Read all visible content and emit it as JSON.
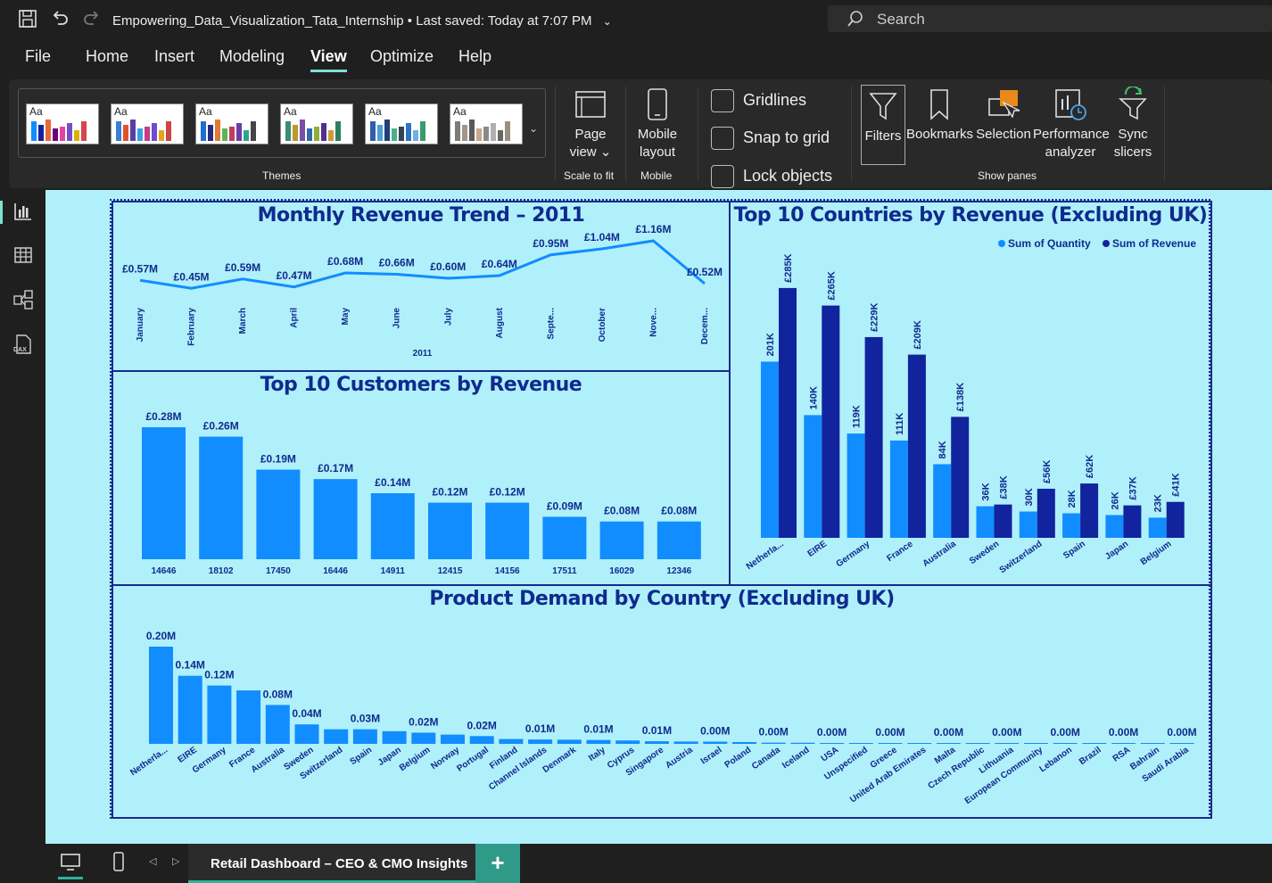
{
  "titlebar": {
    "doc_title": "Empowering_Data_Visualization_Tata_Internship",
    "saved_status": "Last saved: Today at 7:07 PM",
    "search_label": "Search"
  },
  "menu": [
    "File",
    "Home",
    "Insert",
    "Modeling",
    "View",
    "Optimize",
    "Help"
  ],
  "active_menu": "View",
  "ribbon": {
    "themes_label": "Themes",
    "themes": [
      {
        "aa": "Aa",
        "colors": [
          "#118dff",
          "#12239e",
          "#e66c37",
          "#6b007b",
          "#e044a7",
          "#744ec2",
          "#d9b300",
          "#d64550"
        ]
      },
      {
        "aa": "Aa",
        "colors": [
          "#3a7fd5",
          "#e0542c",
          "#5a3fa0",
          "#35a1e6",
          "#c43d8b",
          "#6c4ccf",
          "#e8a21f",
          "#c44"
        ]
      },
      {
        "aa": "Aa",
        "colors": [
          "#1e6fd0",
          "#2a2a7a",
          "#e07b31",
          "#5db55a",
          "#c23c5d",
          "#6d3ba8",
          "#2ca58d",
          "#444"
        ]
      },
      {
        "aa": "Aa",
        "colors": [
          "#3b8d6d",
          "#b99a2f",
          "#7a4fa3",
          "#2f6aa8",
          "#8fae3e",
          "#4f2f90",
          "#d09a3a",
          "#2e7f5e"
        ]
      },
      {
        "aa": "Aa",
        "colors": [
          "#2f5fa8",
          "#48a0d8",
          "#1f3e7a",
          "#4db08c",
          "#345",
          "#2a75c9",
          "#6fb0e0",
          "#3a9a6e"
        ]
      },
      {
        "aa": "Aa",
        "colors": [
          "#7b7b7b",
          "#a0968a",
          "#5a5a5a",
          "#c7a88a",
          "#8a8a8a",
          "#b0b0b0",
          "#666",
          "#9a8f80"
        ]
      }
    ],
    "page_view": {
      "label1": "Page",
      "label2": "view ⌄",
      "group": "Scale to fit"
    },
    "mobile_layout": {
      "label1": "Mobile",
      "label2": "layout",
      "group": "Mobile"
    },
    "checks": {
      "gridlines": "Gridlines",
      "snap": "Snap to grid",
      "lock": "Lock objects"
    },
    "panes": {
      "filters": "Filters",
      "bookmarks": "Bookmarks",
      "selection": "Selection",
      "performance1": "Performance",
      "performance2": "analyzer",
      "sync1": "Sync",
      "sync2": "slicers",
      "group": "Show panes"
    }
  },
  "colors": {
    "bar_light": "#118dff",
    "bar_dark": "#12239e",
    "title": "#102a8e",
    "canvas": "#b0f0fa"
  },
  "chart_data": [
    {
      "type": "line",
      "title": "Monthly Revenue Trend – 2011",
      "xlabel": "2011",
      "categories": [
        "January",
        "February",
        "March",
        "April",
        "May",
        "June",
        "July",
        "August",
        "Septe...",
        "October",
        "Nove...",
        "Decem..."
      ],
      "values": [
        0.57,
        0.45,
        0.59,
        0.47,
        0.68,
        0.66,
        0.6,
        0.64,
        0.95,
        1.04,
        1.16,
        0.52
      ],
      "value_labels": [
        "£0.57M",
        "£0.45M",
        "£0.59M",
        "£0.47M",
        "£0.68M",
        "£0.66M",
        "£0.60M",
        "£0.64M",
        "£0.95M",
        "£1.04M",
        "£1.16M",
        "£0.52M"
      ],
      "grid": false
    },
    {
      "type": "bar",
      "title": "Top 10 Customers by Revenue",
      "categories": [
        "14646",
        "18102",
        "17450",
        "16446",
        "14911",
        "12415",
        "14156",
        "17511",
        "16029",
        "12346"
      ],
      "values": [
        0.28,
        0.26,
        0.19,
        0.17,
        0.14,
        0.12,
        0.12,
        0.09,
        0.08,
        0.08
      ],
      "value_labels": [
        "£0.28M",
        "£0.26M",
        "£0.19M",
        "£0.17M",
        "£0.14M",
        "£0.12M",
        "£0.12M",
        "£0.09M",
        "£0.08M",
        "£0.08M"
      ],
      "grid": false
    },
    {
      "type": "bar",
      "title": "Top 10 Countries by Revenue (Excluding UK)",
      "legend_position": "top-right",
      "categories": [
        "Netherla...",
        "EIRE",
        "Germany",
        "France",
        "Australia",
        "Sweden",
        "Switzerland",
        "Spain",
        "Japan",
        "Belgium"
      ],
      "series": [
        {
          "name": "Sum of Quantity",
          "values": [
            201,
            140,
            119,
            111,
            84,
            36,
            30,
            28,
            26,
            23
          ],
          "labels": [
            "201K",
            "140K",
            "119K",
            "111K",
            "84K",
            "36K",
            "30K",
            "28K",
            "26K",
            "23K"
          ]
        },
        {
          "name": "Sum of Revenue",
          "values": [
            285,
            265,
            229,
            209,
            138,
            38,
            56,
            62,
            37,
            41
          ],
          "labels": [
            "£285K",
            "£265K",
            "£229K",
            "£209K",
            "£138K",
            "£38K",
            "£56K",
            "£62K",
            "£37K",
            "£41K"
          ]
        }
      ],
      "grid": false
    },
    {
      "type": "bar",
      "title": "Product Demand by Country (Excluding UK)",
      "categories": [
        "Netherla...",
        "EIRE",
        "Germany",
        "France",
        "Australia",
        "Sweden",
        "Switzerland",
        "Spain",
        "Japan",
        "Belgium",
        "Norway",
        "Portugal",
        "Finland",
        "Channel Islands",
        "Denmark",
        "Italy",
        "Cyprus",
        "Singapore",
        "Austria",
        "Israel",
        "Poland",
        "Canada",
        "Iceland",
        "USA",
        "Unspecified",
        "Greece",
        "United Arab Emirates",
        "Malta",
        "Czech Republic",
        "Lithuania",
        "European Community",
        "Lebanon",
        "Brazil",
        "RSA",
        "Bahrain",
        "Saudi Arabia"
      ],
      "values": [
        0.2,
        0.14,
        0.12,
        0.11,
        0.08,
        0.04,
        0.03,
        0.03,
        0.026,
        0.023,
        0.019,
        0.016,
        0.01,
        0.009,
        0.0085,
        0.008,
        0.007,
        0.0054,
        0.0048,
        0.0046,
        0.0037,
        0.0024,
        0.0023,
        0.0011,
        0.0011,
        0.0009,
        0.0006,
        0.0005,
        0.0006,
        0.0006,
        0.0004,
        0.0004,
        0.0004,
        0.0003,
        0.0003,
        0.0001
      ],
      "value_labels": [
        "0.20M",
        "0.14M",
        "0.12M",
        "",
        "0.08M",
        "0.04M",
        "",
        "0.03M",
        "",
        "0.02M",
        "",
        "0.02M",
        "",
        "0.01M",
        "",
        "0.01M",
        "",
        "0.01M",
        "",
        "0.00M",
        "",
        "0.00M",
        "",
        "0.00M",
        "",
        "0.00M",
        "",
        "0.00M",
        "",
        "0.00M",
        "",
        "0.00M",
        "",
        "0.00M",
        "",
        "0.00M"
      ],
      "grid": false
    }
  ],
  "bottombar": {
    "page_tab": "Retail Dashboard – CEO & CMO Insights",
    "add": "+"
  }
}
